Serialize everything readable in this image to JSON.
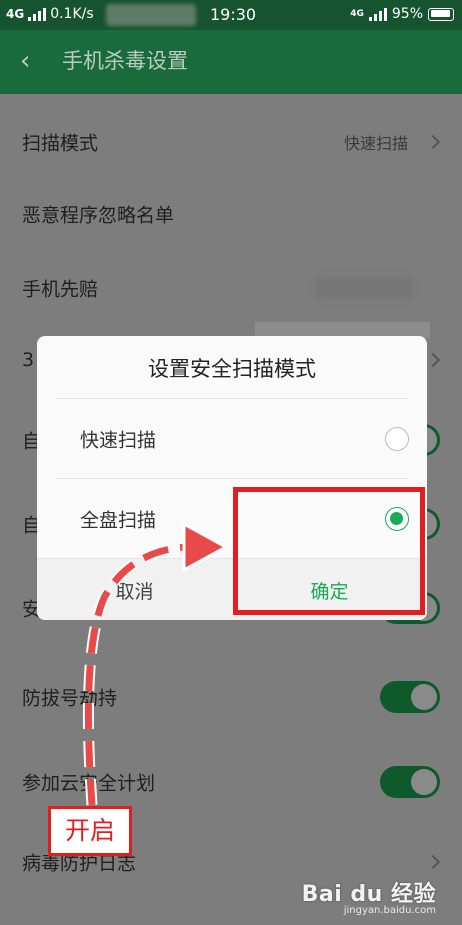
{
  "status_bar": {
    "network_left": "4G",
    "speed": "0.1K/s",
    "time": "19:30",
    "network_right": "4G",
    "battery": "95%"
  },
  "toolbar": {
    "back_icon": "chevron-left-icon",
    "title": "手机杀毒设置"
  },
  "settings": [
    {
      "label": "扫描模式",
      "value": "快速扫描",
      "control": "chevron"
    },
    {
      "label": "恶意程序忽略名单",
      "value": "",
      "control": "none"
    },
    {
      "label": "手机先赔",
      "value": "",
      "control": "blurred"
    },
    {
      "label": "3",
      "value": "",
      "control": "chevron"
    },
    {
      "label": "自",
      "value": "",
      "control": "toggle",
      "on": true
    },
    {
      "label": "自",
      "value": "",
      "control": "toggle",
      "on": true
    },
    {
      "label": "安",
      "value": "",
      "control": "toggle",
      "on": true
    },
    {
      "label": "防拔号劫持",
      "value": "",
      "control": "toggle",
      "on": true
    },
    {
      "label": "参加云安全计划",
      "value": "",
      "control": "toggle",
      "on": true
    },
    {
      "label": "病毒防护日志",
      "value": "",
      "control": "chevron"
    }
  ],
  "dialog": {
    "title": "设置安全扫描模式",
    "options": [
      {
        "label": "快速扫描",
        "selected": false
      },
      {
        "label": "全盘扫描",
        "selected": true
      }
    ],
    "cancel_label": "取消",
    "ok_label": "确定"
  },
  "annotation": {
    "note": "开启",
    "color": "#e02020"
  },
  "watermark": {
    "logo": "Bai du 经验",
    "url": "jingyan.baidu.com"
  },
  "colors": {
    "accent": "#1aaa55",
    "toolbar": "#1a6b3b",
    "statusbar": "#16532f"
  }
}
